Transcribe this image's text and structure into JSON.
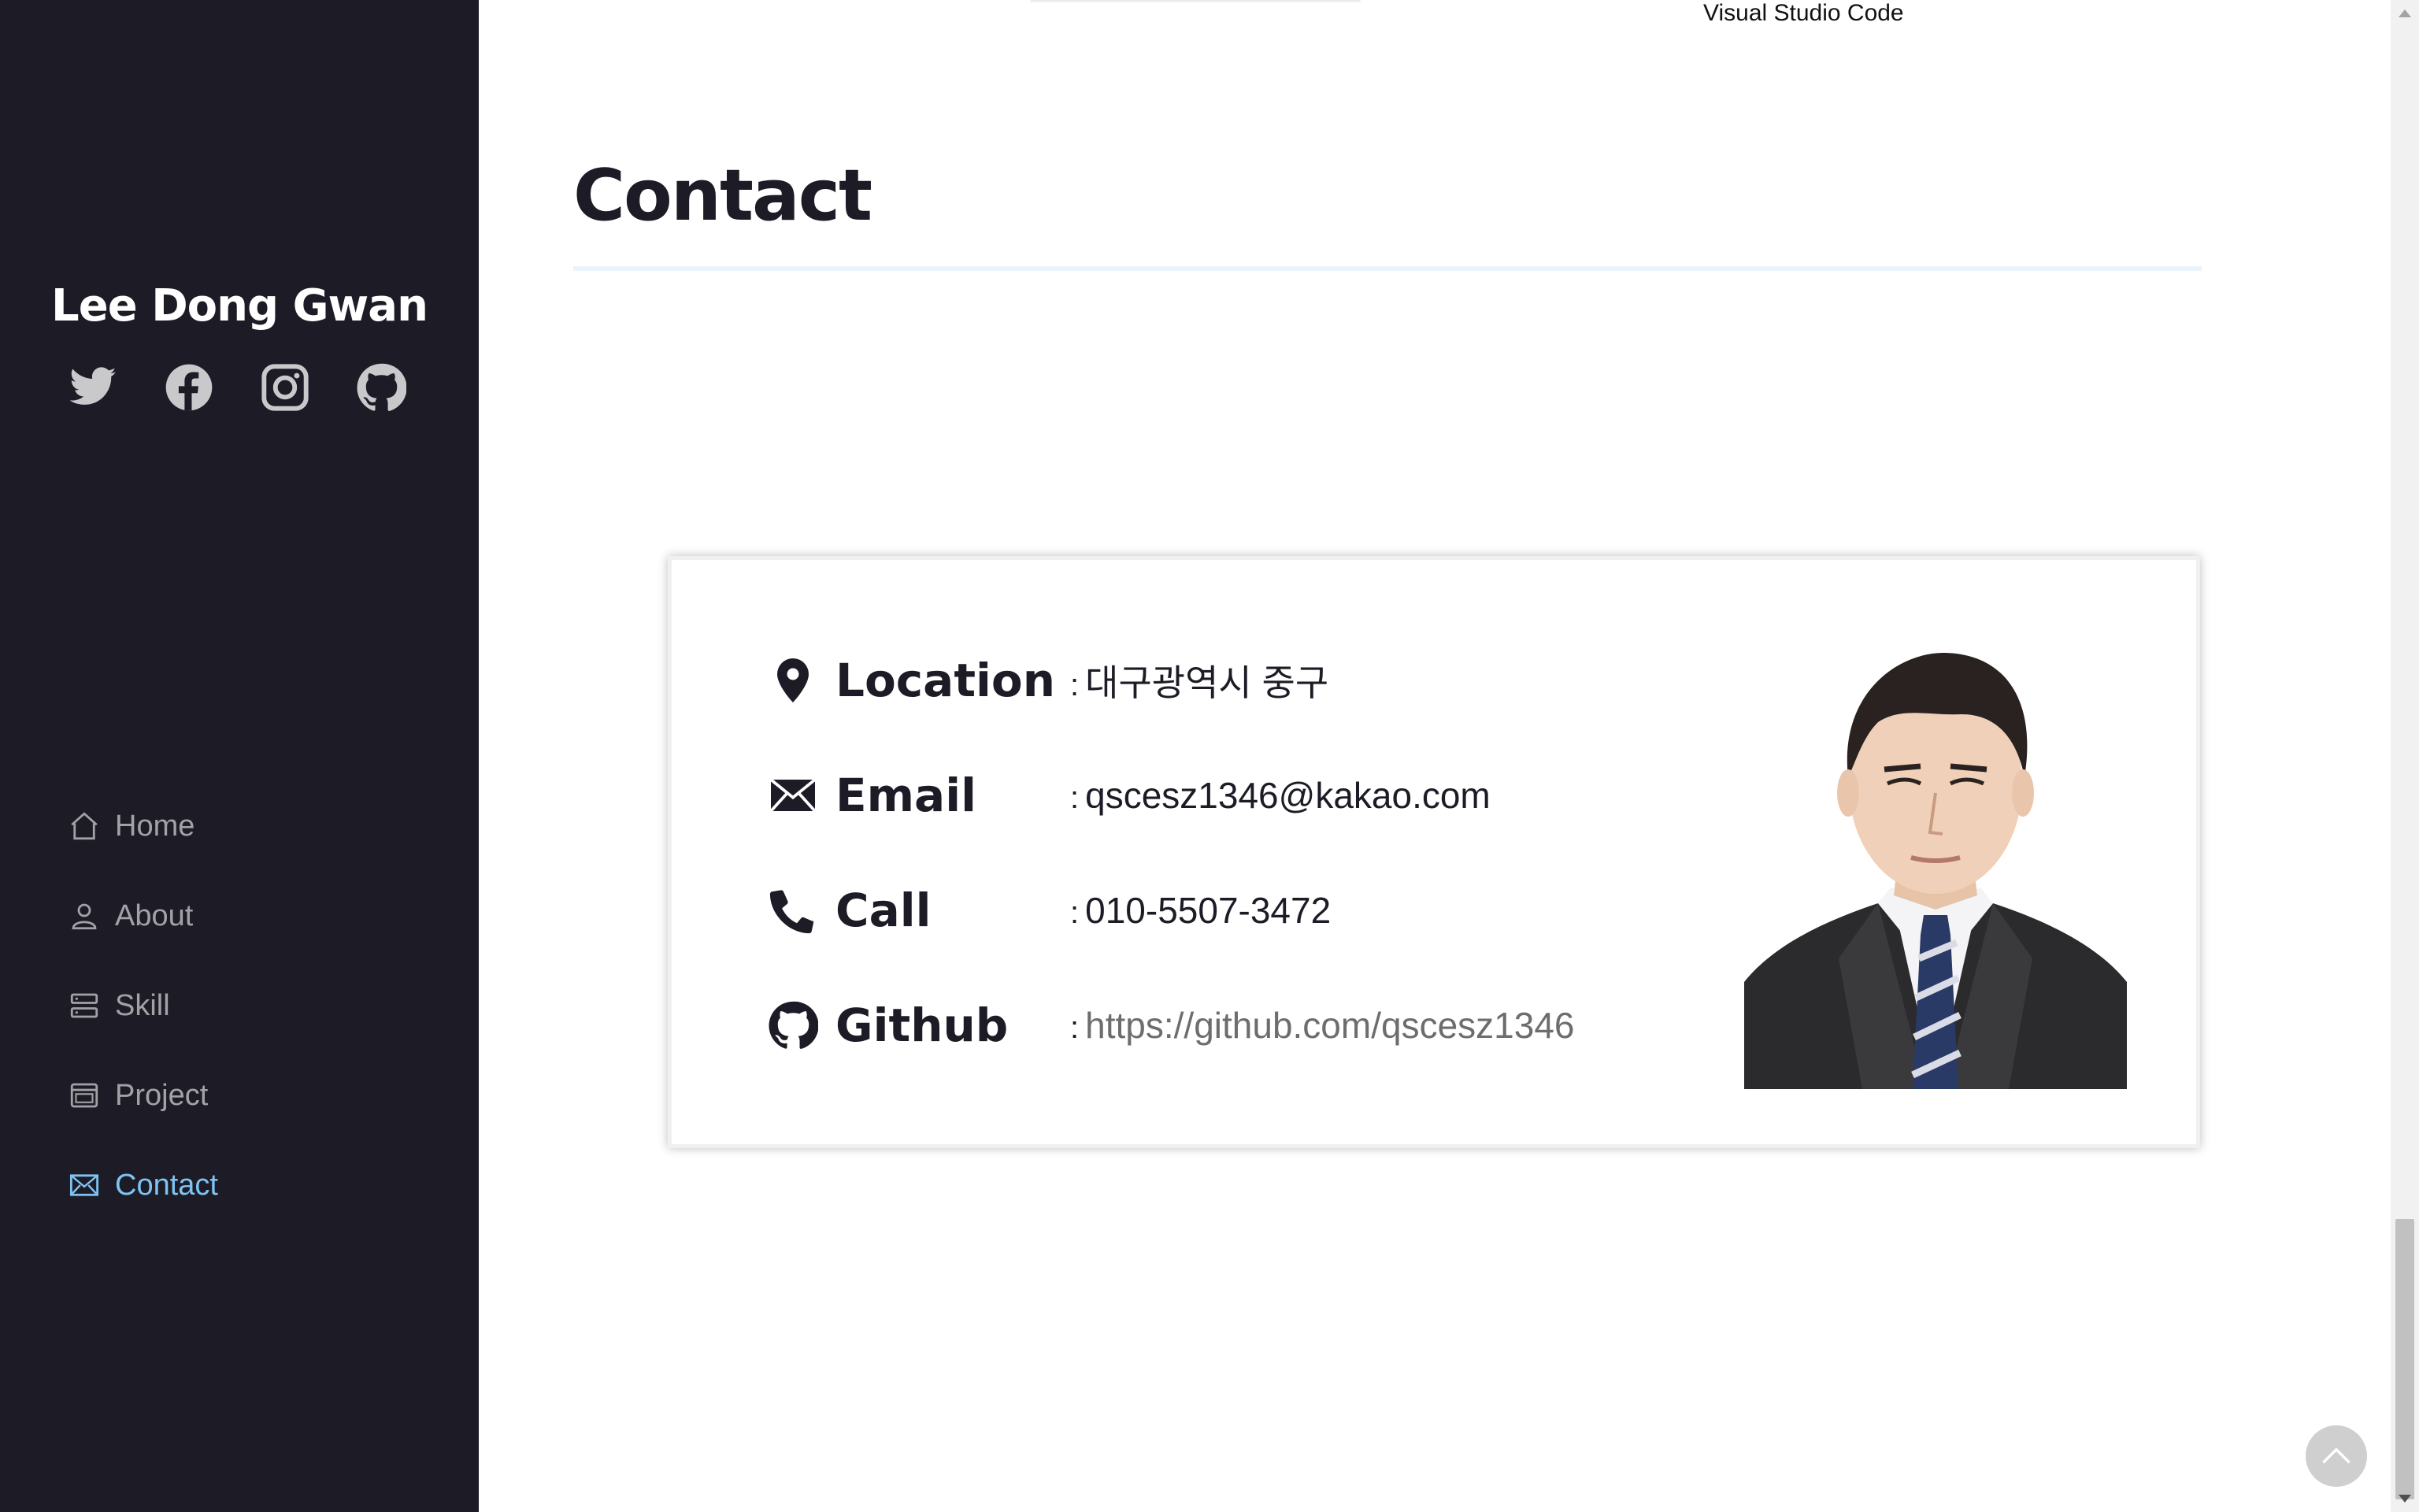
{
  "sidebar": {
    "brand": "Lee Dong Gwan",
    "socials": [
      {
        "name": "twitter-icon"
      },
      {
        "name": "facebook-icon"
      },
      {
        "name": "instagram-icon"
      },
      {
        "name": "github-icon"
      }
    ],
    "nav": [
      {
        "label": "Home",
        "icon": "home-icon"
      },
      {
        "label": "About",
        "icon": "user-icon"
      },
      {
        "label": "Skill",
        "icon": "server-icon"
      },
      {
        "label": "Project",
        "icon": "window-icon"
      },
      {
        "label": "Contact",
        "icon": "envelope-icon",
        "active": true
      }
    ],
    "colors": {
      "background": "#1d1c26",
      "active": "#7ec3f2",
      "inactive": "#a2a2a6"
    }
  },
  "main": {
    "partial_label": "Visual Studio Code",
    "section_title": "Contact",
    "contact": {
      "location": {
        "label": "Location",
        "value": "대구광역시 중구"
      },
      "email": {
        "label": "Email",
        "value": "qscesz1346@kakao.com"
      },
      "call": {
        "label": "Call",
        "value": "010-5507-3472"
      },
      "github": {
        "label": "Github",
        "value": "https://github.com/qscesz1346"
      },
      "separator": ":"
    }
  }
}
